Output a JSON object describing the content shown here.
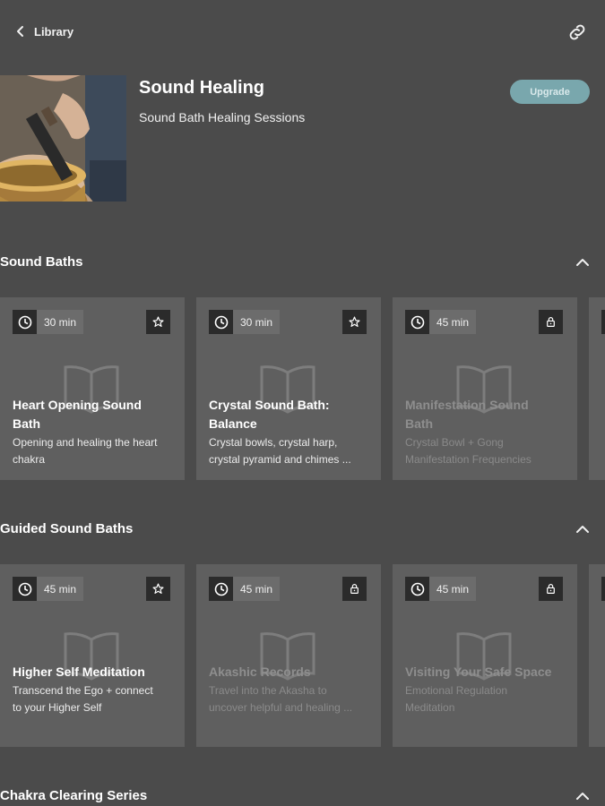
{
  "topbar": {
    "back_label": "Library",
    "back_icon": "chevron-left-icon",
    "link_icon": "link-icon"
  },
  "header": {
    "title": "Sound Healing",
    "subtitle": "Sound Bath Healing Sessions",
    "upgrade_label": "Upgrade"
  },
  "sections": [
    {
      "title": "Sound Baths",
      "cards": [
        {
          "duration": "30 min",
          "badge": "star-icon",
          "title_l1": "Heart Opening Sound",
          "title_l2": "Bath",
          "desc_l1": "Opening and healing the heart",
          "desc_l2": "chakra",
          "locked": false
        },
        {
          "duration": "30 min",
          "badge": "star-icon",
          "title_l1": "Crystal Sound Bath:",
          "title_l2": "Balance",
          "desc_l1": "Crystal bowls, crystal harp,",
          "desc_l2": "crystal pyramid and chimes ...",
          "locked": false
        },
        {
          "duration": "45 min",
          "badge": "lock-icon",
          "title_l1": "Manifestation Sound",
          "title_l2": "Bath",
          "desc_l1": "Crystal Bowl + Gong",
          "desc_l2": "Manifestation Frequencies",
          "locked": true
        }
      ]
    },
    {
      "title": "Guided Sound Baths",
      "cards": [
        {
          "duration": "45 min",
          "badge": "star-icon",
          "title_l1": "Higher Self Meditation",
          "title_l2": "",
          "desc_l1": "Transcend the Ego + connect",
          "desc_l2": "to your Higher Self",
          "locked": false
        },
        {
          "duration": "45 min",
          "badge": "lock-icon",
          "title_l1": "Akashic Records",
          "title_l2": "",
          "desc_l1": "Travel into the Akasha to",
          "desc_l2": "uncover helpful and healing ...",
          "locked": true
        },
        {
          "duration": "45 min",
          "badge": "lock-icon",
          "title_l1": "Visiting Your Safe Space",
          "title_l2": "",
          "desc_l1": "Emotional Regulation",
          "desc_l2": "Meditation",
          "locked": true
        }
      ]
    },
    {
      "title": "Chakra Clearing Series",
      "cards": []
    }
  ],
  "colors": {
    "background": "#4b4b4b",
    "card": "#5f5f5f",
    "accent": "#79a7ad"
  }
}
